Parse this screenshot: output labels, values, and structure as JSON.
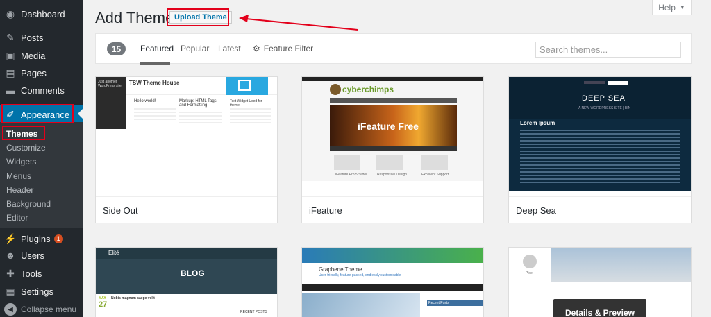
{
  "sidebar": {
    "items": [
      {
        "label": "Dashboard",
        "icon": "dashboard-icon"
      },
      {
        "label": "Posts",
        "icon": "pin-icon"
      },
      {
        "label": "Media",
        "icon": "media-icon"
      },
      {
        "label": "Pages",
        "icon": "pages-icon"
      },
      {
        "label": "Comments",
        "icon": "comment-icon"
      },
      {
        "label": "Appearance",
        "icon": "brush-icon"
      },
      {
        "label": "Plugins",
        "icon": "plug-icon",
        "badge": "1"
      },
      {
        "label": "Users",
        "icon": "users-icon"
      },
      {
        "label": "Tools",
        "icon": "wrench-icon"
      },
      {
        "label": "Settings",
        "icon": "settings-icon"
      }
    ],
    "submenu": [
      "Themes",
      "Customize",
      "Widgets",
      "Menus",
      "Header",
      "Background",
      "Editor"
    ],
    "collapse_label": "Collapse menu"
  },
  "header": {
    "title": "Add Themes",
    "upload_label": "Upload Theme",
    "help_label": "Help"
  },
  "filter": {
    "count": "15",
    "tabs": [
      "Featured",
      "Popular",
      "Latest"
    ],
    "feature_filter": "Feature Filter",
    "search_placeholder": "Search themes..."
  },
  "themes": [
    {
      "name": "Side Out"
    },
    {
      "name": "iFeature"
    },
    {
      "name": "Deep Sea"
    }
  ],
  "shots": {
    "sideout": {
      "site_title": "Just another WordPress site",
      "header_title": "TSW Theme House",
      "post1": "Hello world!",
      "post2": "Markup: HTML Tags and Formatting",
      "post3": "Text Widget Used for theme"
    },
    "ifeature": {
      "logo": "cyberchimps",
      "hero": "iFeature Free",
      "box1": "iFeature Pro 5 Slider",
      "box2": "Responsive Design",
      "box3": "Excellent Support"
    },
    "deepsea": {
      "title": "DEEP SEA",
      "tagline": "A NEW WORDPRESS SITE | BIN",
      "heading": "Lorem Ipsum"
    },
    "elite": {
      "brand": "Elitē",
      "banner": "BLOG",
      "month": "MAY",
      "day": "27",
      "post_title": "Nobis magnam saepe velit",
      "recent": "RECENT POSTS"
    },
    "graphene": {
      "title": "Graphene Theme",
      "tagline": "User-friendly, feature-packed, endlessly customisable",
      "recent": "Recent Posts"
    },
    "pixel": {
      "author": "Pixel",
      "overlay": "Details & Preview"
    }
  },
  "colors": {
    "sidebar_bg": "#23282d",
    "active": "#0073aa",
    "annotation": "#e3001b"
  }
}
